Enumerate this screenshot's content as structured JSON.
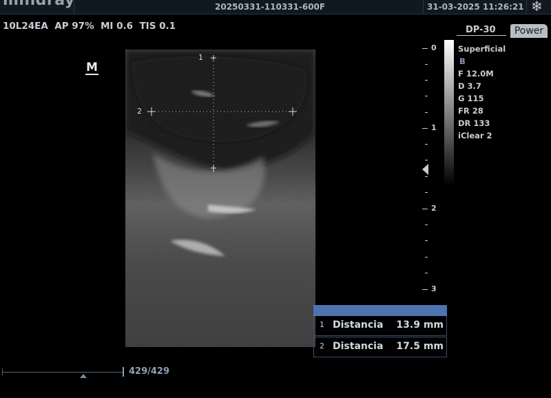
{
  "header": {
    "brand": "mindray",
    "patient_id": "20250331-110331-600F",
    "datetime": "31-03-2025 11:26:21",
    "freeze_icon": "snowflake-icon"
  },
  "acquisition": {
    "params_line": "10L24EA  AP 97%  MI 0.6  TIS 0.1",
    "marker": "M"
  },
  "probe": {
    "model": "DP-30",
    "power_label": "Power"
  },
  "settings": {
    "preset": "Superficial",
    "mode": "B",
    "frequency": "F 12.0M",
    "depth": "D 3.7",
    "gain": "G 115",
    "frame_rate": "FR 28",
    "dynamic_range": "DR 133",
    "iclear": "iClear 2"
  },
  "depth_scale": {
    "labels": [
      "0",
      "1",
      "2",
      "3"
    ],
    "focus_icon": "focus-marker-icon"
  },
  "calipers": [
    {
      "index": "1"
    },
    {
      "index": "2"
    }
  ],
  "measurements": [
    {
      "index": "1",
      "name": "Distancia",
      "value": "13.9 mm"
    },
    {
      "index": "2",
      "name": "Distancia",
      "value": "17.5 mm"
    }
  ],
  "cine": {
    "frame_counter": "429/429"
  }
}
